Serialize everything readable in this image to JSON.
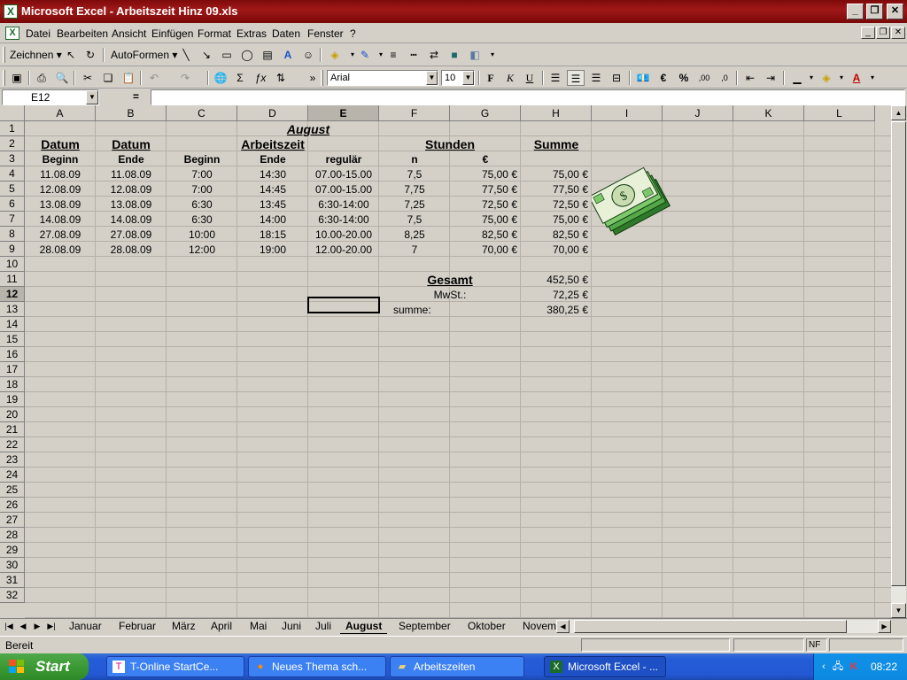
{
  "window": {
    "title": "Microsoft Excel - Arbeitszeit Hinz 09.xls",
    "buttons": {
      "minimize": "_",
      "maximize": "❐",
      "close": "✕"
    }
  },
  "menu": [
    "Datei",
    "Bearbeiten",
    "Ansicht",
    "Einfügen",
    "Format",
    "Extras",
    "Daten",
    "Fenster",
    "?"
  ],
  "drawing_toolbar": {
    "zeichnen_label": "Zeichnen",
    "autoformen_label": "AutoFormen"
  },
  "format_toolbar": {
    "font_name": "Arial",
    "font_size": "10"
  },
  "formula_bar": {
    "name_box": "E12",
    "equals": "=",
    "content": ""
  },
  "columns": [
    "A",
    "B",
    "C",
    "D",
    "E",
    "F",
    "G",
    "H",
    "I",
    "J",
    "K",
    "L"
  ],
  "selected_column": "E",
  "selected_row": "12",
  "rows": [
    "1",
    "2",
    "3",
    "4",
    "5",
    "6",
    "7",
    "8",
    "9",
    "10",
    "11",
    "12",
    "13",
    "14",
    "15",
    "16",
    "17",
    "18",
    "19",
    "20",
    "21",
    "22",
    "23",
    "24",
    "25",
    "26",
    "27",
    "28",
    "29",
    "30",
    "31",
    "32"
  ],
  "sheet": {
    "title": "August",
    "h_datum1": "Datum",
    "h_datum2": "Datum",
    "h_arbeitszeit": "Arbeitszeit",
    "h_stunden": "Stunden",
    "h_summe": "Summe",
    "sub_beginn1": "Beginn",
    "sub_ende1": "Ende",
    "sub_beginn2": "Beginn",
    "sub_ende2": "Ende",
    "sub_regulaer": "regulär",
    "sub_n": "n",
    "sub_euro": "€",
    "data": [
      [
        "11.08.09",
        "11.08.09",
        "7:00",
        "14:30",
        "07.00-15.00",
        "7,5",
        "75,00 €",
        "75,00 €"
      ],
      [
        "12.08.09",
        "12.08.09",
        "7:00",
        "14:45",
        "07.00-15.00",
        "7,75",
        "77,50 €",
        "77,50 €"
      ],
      [
        "13.08.09",
        "13.08.09",
        "6:30",
        "13:45",
        "6:30-14:00",
        "7,25",
        "72,50 €",
        "72,50 €"
      ],
      [
        "14.08.09",
        "14.08.09",
        "6:30",
        "14:00",
        "6:30-14:00",
        "7,5",
        "75,00 €",
        "75,00 €"
      ],
      [
        "27.08.09",
        "27.08.09",
        "10:00",
        "18:15",
        "10.00-20.00",
        "8,25",
        "82,50 €",
        "82,50 €"
      ],
      [
        "28.08.09",
        "28.08.09",
        "12:00",
        "19:00",
        "12.00-20.00",
        "7",
        "70,00 €",
        "70,00 €"
      ]
    ],
    "gesamt_label": "Gesamt",
    "gesamt_value": "452,50 €",
    "mwst_label": "MwSt.:",
    "mwst_value": "72,25 €",
    "summe_label": "summe:",
    "summe_value": "380,25 €"
  },
  "tabs": [
    "Januar",
    "Februar",
    "März",
    "April",
    "Mai",
    "Juni",
    "Juli",
    "August",
    "September",
    "Oktober",
    "Novem"
  ],
  "active_tab": "August",
  "status": {
    "text": "Bereit",
    "nf": "NF"
  },
  "taskbar": {
    "start": "Start",
    "tasks": [
      {
        "label": "T-Online StartCe...",
        "icon": "t-online-icon"
      },
      {
        "label": "Neues Thema sch...",
        "icon": "firefox-icon"
      },
      {
        "label": "Arbeitszeiten",
        "icon": "folder-icon"
      },
      {
        "label": "Microsoft Excel - ...",
        "icon": "excel-icon"
      }
    ],
    "clock": "08:22"
  },
  "colors": {
    "titlebar": "#8b0f0f",
    "taskbar": "#245dd7",
    "start": "#3c9a35",
    "face": "#d4d0c8"
  }
}
